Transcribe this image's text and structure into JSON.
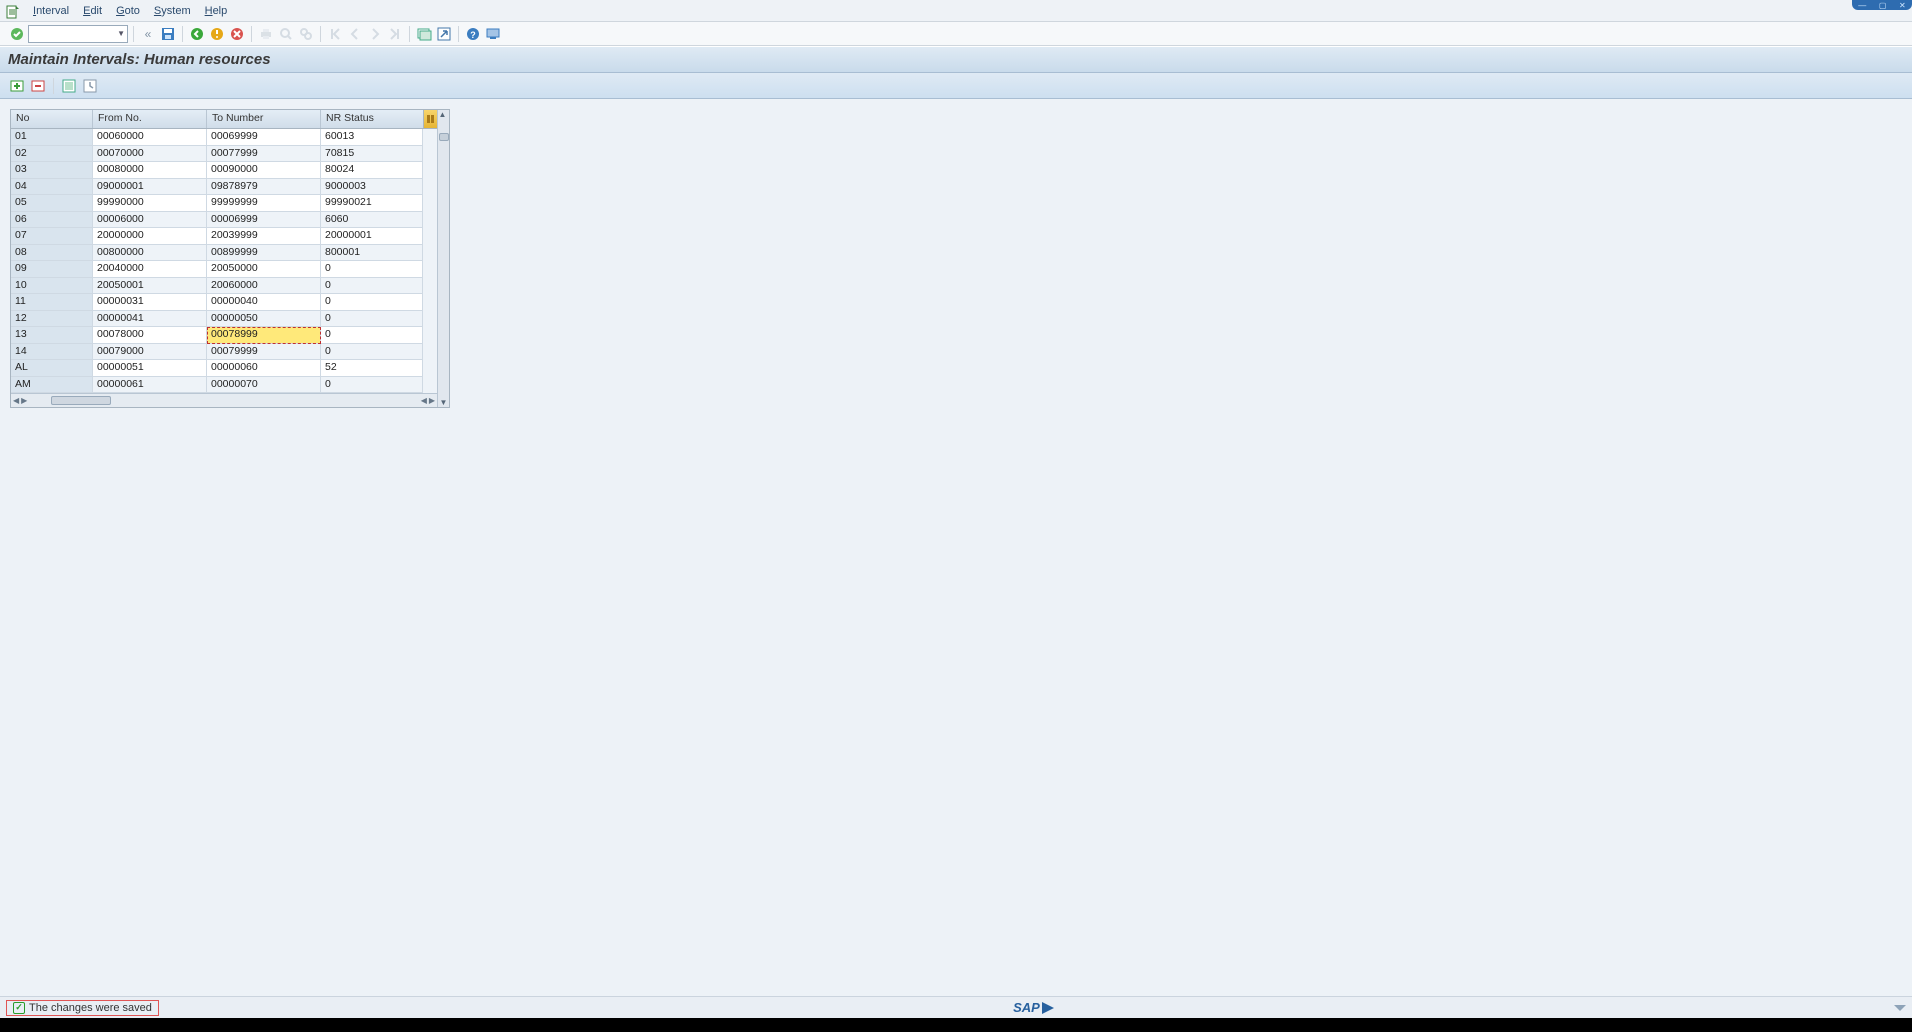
{
  "menu": {
    "items": [
      {
        "label": "Interval",
        "accel": "I"
      },
      {
        "label": "Edit",
        "accel": "E"
      },
      {
        "label": "Goto",
        "accel": "G"
      },
      {
        "label": "System",
        "accel": "S"
      },
      {
        "label": "Help",
        "accel": "H"
      }
    ]
  },
  "page_title": "Maintain Intervals: Human resources",
  "table": {
    "columns": [
      "No",
      "From No.",
      "To Number",
      "NR Status"
    ],
    "rows": [
      {
        "no": "01",
        "from": "00060000",
        "to": "00069999",
        "status": "60013"
      },
      {
        "no": "02",
        "from": "00070000",
        "to": "00077999",
        "status": "70815"
      },
      {
        "no": "03",
        "from": "00080000",
        "to": "00090000",
        "status": "80024"
      },
      {
        "no": "04",
        "from": "09000001",
        "to": "09878979",
        "status": "9000003"
      },
      {
        "no": "05",
        "from": "99990000",
        "to": "99999999",
        "status": "99990021"
      },
      {
        "no": "06",
        "from": "00006000",
        "to": "00006999",
        "status": "6060"
      },
      {
        "no": "07",
        "from": "20000000",
        "to": "20039999",
        "status": "20000001"
      },
      {
        "no": "08",
        "from": "00800000",
        "to": "00899999",
        "status": "800001"
      },
      {
        "no": "09",
        "from": "20040000",
        "to": "20050000",
        "status": "0"
      },
      {
        "no": "10",
        "from": "20050001",
        "to": "20060000",
        "status": "0"
      },
      {
        "no": "11",
        "from": "00000031",
        "to": "00000040",
        "status": "0"
      },
      {
        "no": "12",
        "from": "00000041",
        "to": "00000050",
        "status": "0"
      },
      {
        "no": "13",
        "from": "00078000",
        "to": "00078999",
        "status": "0",
        "editing": "to"
      },
      {
        "no": "14",
        "from": "00079000",
        "to": "00079999",
        "status": "0"
      },
      {
        "no": "AL",
        "from": "00000051",
        "to": "00000060",
        "status": "52"
      },
      {
        "no": "AM",
        "from": "00000061",
        "to": "00000070",
        "status": "0"
      }
    ]
  },
  "status_message": "The changes were saved",
  "sap_logo_text": "SAP"
}
